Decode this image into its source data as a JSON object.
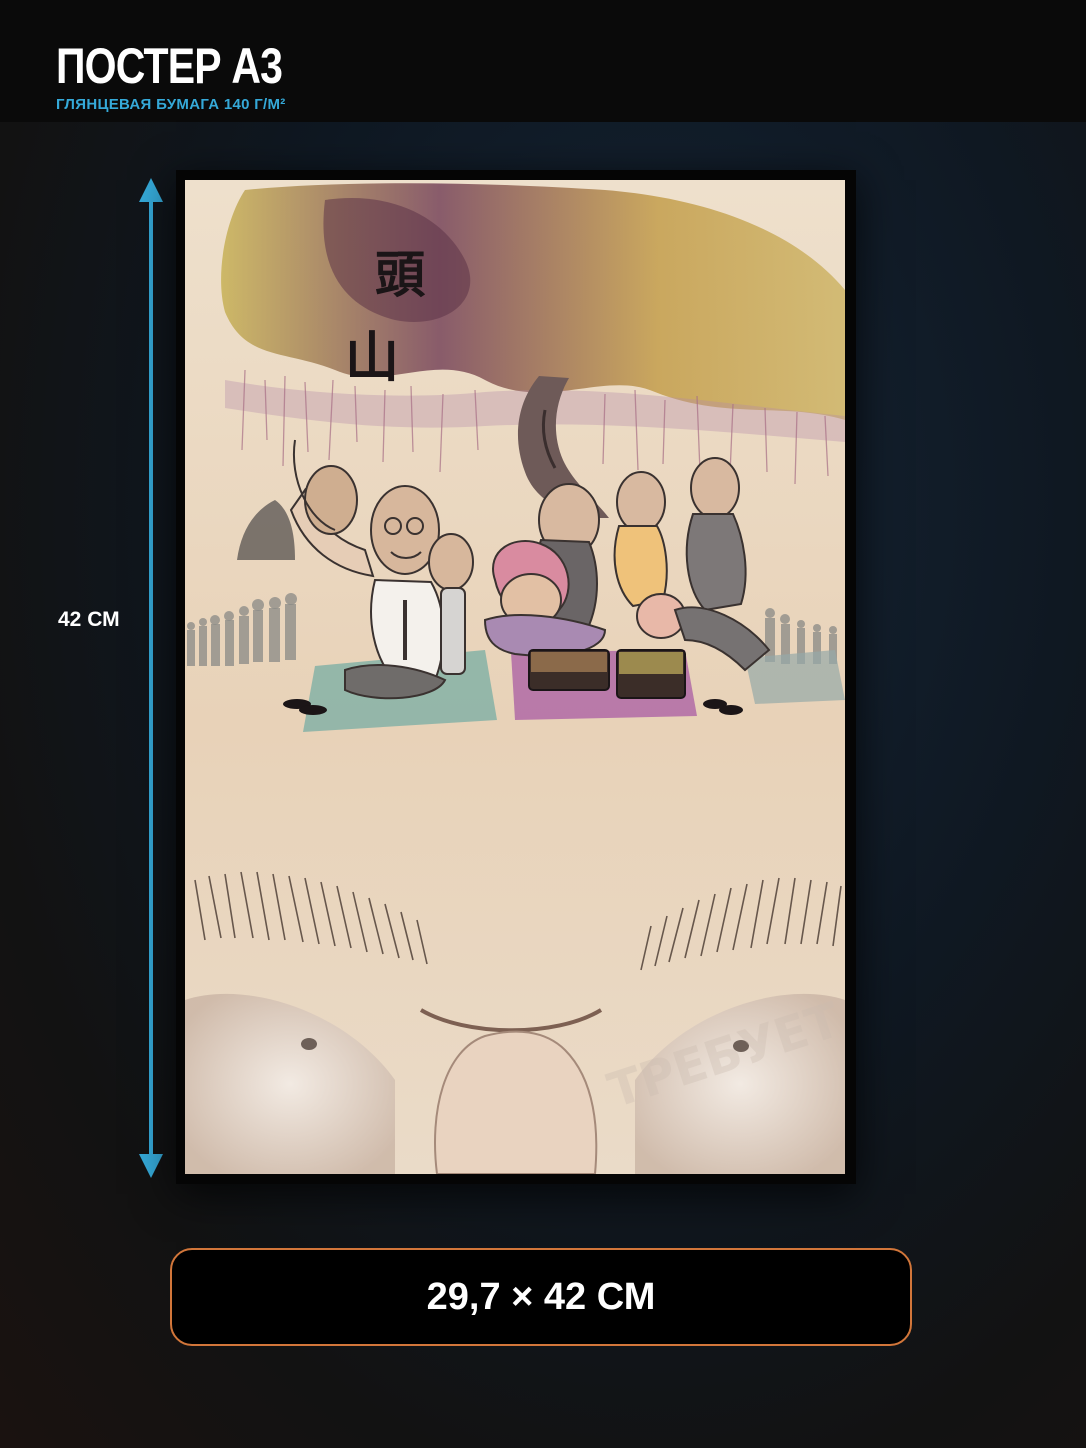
{
  "header": {
    "title": "ПОСТЕР А3",
    "subtitle": "ГЛЯНЦЕВАЯ БУМАГА 140 Г/М²"
  },
  "dimension": {
    "height_label": "42 СМ",
    "size_label": "29,7 × 42 СМ"
  },
  "poster": {
    "title_glyphs": "頭山"
  },
  "colors": {
    "accent_cyan": "#35a9d8",
    "accent_orange": "#d2763a",
    "header_bg": "#0a0a0a",
    "poster_paper": "#ecd8c2"
  }
}
